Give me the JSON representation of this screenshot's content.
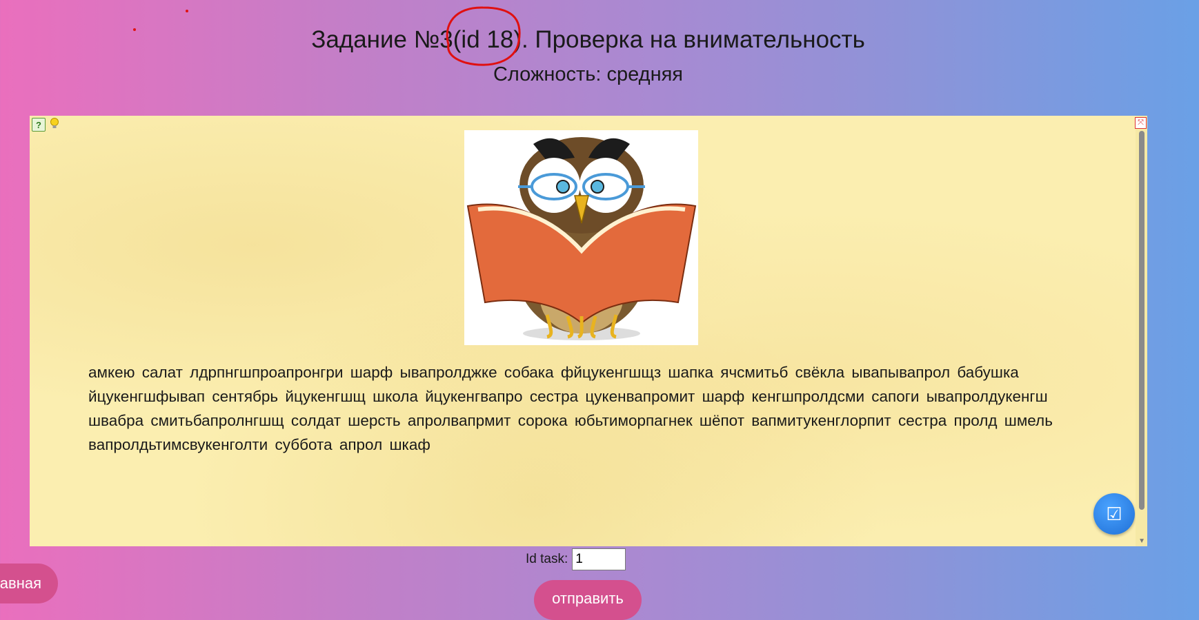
{
  "header": {
    "title": "Задание №3(id 18). Проверка на внимательность",
    "subtitle": "Сложность: средняя"
  },
  "panel": {
    "icons": [
      "help-icon",
      "lightbulb-icon",
      "fullscreen-icon",
      "scroll-down-icon",
      "checkmark-icon"
    ],
    "task_text": "амкею салат лдрпнгшпроапронгри шарф ывапролджке собака фйцукенгшщз шапка ячсмитьб свёкла ывапывапрол бабушка йцукенгшфывап сентябрь йцукенгшщ школа йцукенгвапро сестра цукенвапромит шарф кенгшпролдсми сапоги ывапролдукенгш швабра смитьбапролнгшщ солдат шерсть апролвапрмит сорока юбьтиморпагнек шёпот вапмитукенглорпит сестра пролд шмель вапролдьтимсвукенголти суббота апрол шкаф"
  },
  "form": {
    "id_task_label": "Id task:",
    "id_task_value": "1",
    "send_label": "отправить"
  },
  "nav": {
    "home_label": "авная"
  },
  "colors": {
    "accent": "#d4508e",
    "annotation": "#e01010",
    "panel_bg": "#fbeeb0"
  }
}
